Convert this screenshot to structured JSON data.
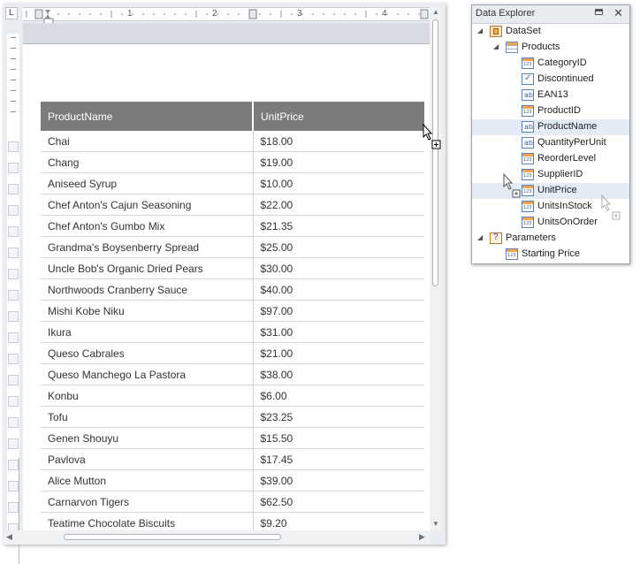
{
  "designer": {
    "corner_label": "L",
    "ruler_numbers": [
      "1",
      "2",
      "3",
      "4"
    ],
    "table": {
      "headers": [
        "ProductName",
        "UnitPrice"
      ],
      "rows": [
        [
          "Chai",
          "$18.00"
        ],
        [
          "Chang",
          "$19.00"
        ],
        [
          "Aniseed Syrup",
          "$10.00"
        ],
        [
          "Chef Anton's Cajun Seasoning",
          "$22.00"
        ],
        [
          "Chef Anton's Gumbo Mix",
          "$21.35"
        ],
        [
          "Grandma's Boysenberry Spread",
          "$25.00"
        ],
        [
          "Uncle Bob's Organic Dried Pears",
          "$30.00"
        ],
        [
          "Northwoods Cranberry Sauce",
          "$40.00"
        ],
        [
          "Mishi Kobe Niku",
          "$97.00"
        ],
        [
          "Ikura",
          "$31.00"
        ],
        [
          "Queso Cabrales",
          "$21.00"
        ],
        [
          "Queso Manchego La Pastora",
          "$38.00"
        ],
        [
          "Konbu",
          "$6.00"
        ],
        [
          "Tofu",
          "$23.25"
        ],
        [
          "Genen Shouyu",
          "$15.50"
        ],
        [
          "Pavlova",
          "$17.45"
        ],
        [
          "Alice Mutton",
          "$39.00"
        ],
        [
          "Carnarvon Tigers",
          "$62.50"
        ],
        [
          "Teatime Chocolate Biscuits",
          "$9.20"
        ]
      ]
    }
  },
  "explorer": {
    "title": "Data Explorer",
    "pin_icon": "pin-icon",
    "close_label": "✕",
    "dataset_label": "DataSet",
    "table_label": "Products",
    "fields": [
      {
        "label": "CategoryID",
        "icon": "numeric-field-icon",
        "selected": false
      },
      {
        "label": "Discontinued",
        "icon": "boolean-field-icon",
        "selected": false
      },
      {
        "label": "EAN13",
        "icon": "string-field-icon",
        "selected": false
      },
      {
        "label": "ProductID",
        "icon": "numeric-field-icon",
        "selected": false
      },
      {
        "label": "ProductName",
        "icon": "string-field-icon",
        "selected": true
      },
      {
        "label": "QuantityPerUnit",
        "icon": "string-field-icon",
        "selected": false
      },
      {
        "label": "ReorderLevel",
        "icon": "numeric-field-icon",
        "selected": false
      },
      {
        "label": "SupplierID",
        "icon": "numeric-field-icon",
        "selected": false
      },
      {
        "label": "UnitPrice",
        "icon": "numeric-field-icon",
        "selected": true
      },
      {
        "label": "UnitsInStock",
        "icon": "numeric-field-icon",
        "selected": false
      },
      {
        "label": "UnitsOnOrder",
        "icon": "numeric-field-icon",
        "selected": false
      }
    ],
    "parameters_label": "Parameters",
    "parameters": [
      {
        "label": "Starting Price",
        "icon": "numeric-field-icon"
      }
    ]
  }
}
